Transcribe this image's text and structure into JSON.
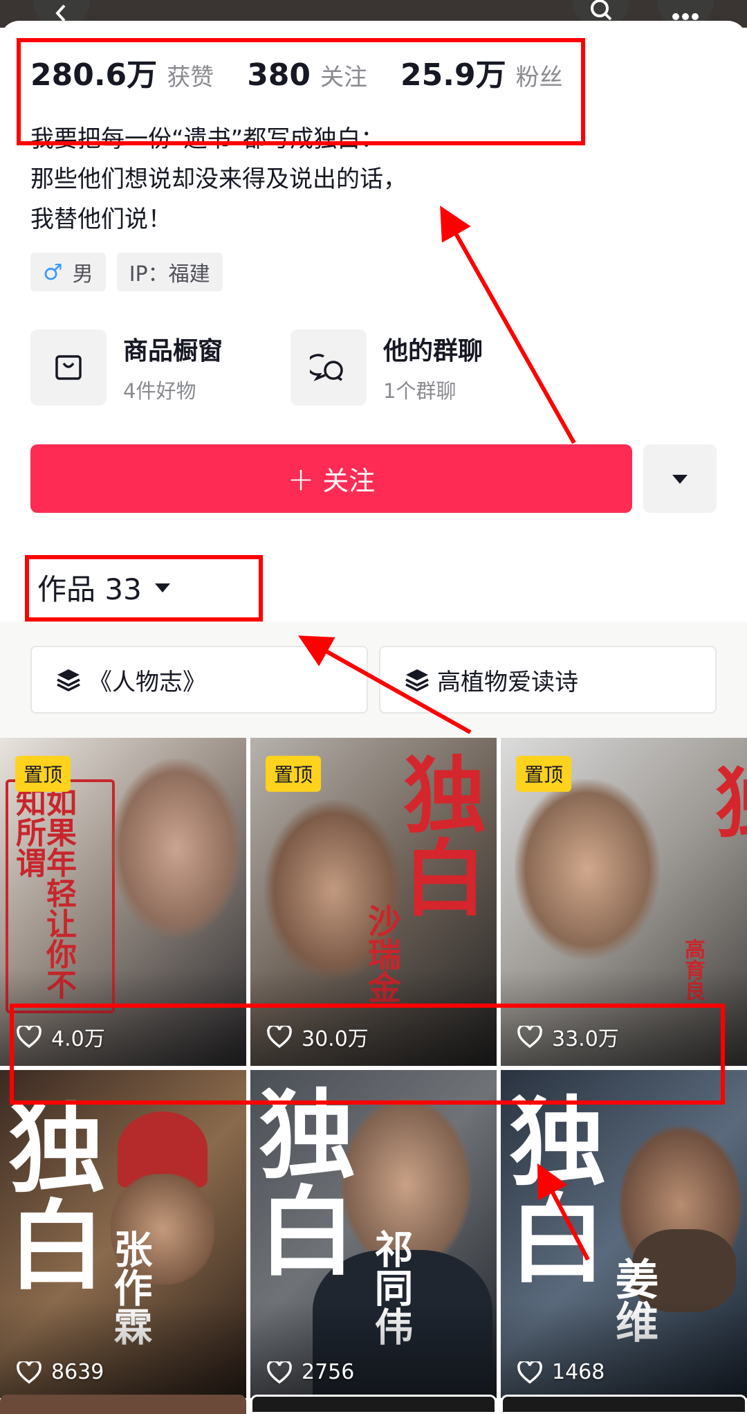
{
  "stats": [
    {
      "value": "280.6万",
      "label": "获赞"
    },
    {
      "value": "380",
      "label": "关注"
    },
    {
      "value": "25.9万",
      "label": "粉丝"
    }
  ],
  "bio": {
    "line1": "我要把每一份“遗书”都写成独白：",
    "line2": "那些他们想说却没来得及说出的话，",
    "line3": "我替他们说！"
  },
  "tags": {
    "gender_symbol": "♂",
    "gender": "男",
    "ip": "IP：福建"
  },
  "features": {
    "shop": {
      "title": "商品橱窗",
      "subtitle": "4件好物"
    },
    "group": {
      "title": "他的群聊",
      "subtitle": "1个群聊"
    }
  },
  "actions": {
    "follow_plus": "+",
    "follow_label": "关注"
  },
  "works": {
    "label": "作品 33"
  },
  "collections": [
    {
      "label": "《人物志》"
    },
    {
      "label": "高植物爱读诗"
    }
  ],
  "videos": [
    {
      "pinned_label": "置顶",
      "likes": "4.0万",
      "overlay": "如果年轻让你不知所谓"
    },
    {
      "pinned_label": "置顶",
      "likes": "30.0万",
      "overlay_big": "独白",
      "overlay_name": "沙瑞金"
    },
    {
      "pinned_label": "置顶",
      "likes": "33.0万",
      "overlay_big": "独",
      "overlay_name": "高育良"
    },
    {
      "likes": "8639",
      "overlay_big": "独白",
      "overlay_name": "张作霖"
    },
    {
      "likes": "2756",
      "overlay_big": "独白",
      "overlay_name": "祁同伟"
    },
    {
      "likes": "1468",
      "overlay_big": "独白",
      "overlay_name": "姜维"
    }
  ],
  "colors": {
    "accent": "#fe2c55",
    "pin_badge": "#ffd21e",
    "annotation": "#ff0000"
  },
  "icons": [
    "back-icon",
    "search-icon",
    "more-icon",
    "shop-bag-icon",
    "group-chat-icon",
    "dropdown-triangle-icon",
    "collection-stack-icon",
    "heart-icon"
  ]
}
